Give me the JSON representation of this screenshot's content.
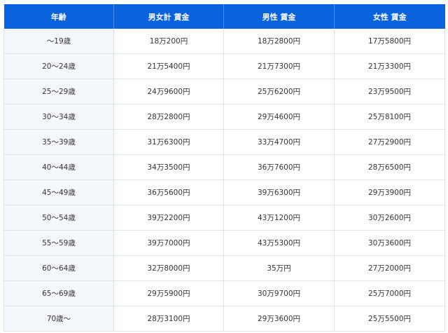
{
  "table": {
    "headers": [
      "年齢",
      "男女計 賃金",
      "男性 賃金",
      "女性 賃金"
    ],
    "rows": [
      {
        "age": "〜19歳",
        "total": "18万200円",
        "male": "18万2800円",
        "female": "17万5800円"
      },
      {
        "age": "20〜24歳",
        "total": "21万5400円",
        "male": "21万7300円",
        "female": "21万3300円"
      },
      {
        "age": "25〜29歳",
        "total": "24万9600円",
        "male": "25万6200円",
        "female": "23万9500円"
      },
      {
        "age": "30〜34歳",
        "total": "28万2800円",
        "male": "29万4600円",
        "female": "25万8100円"
      },
      {
        "age": "35〜39歳",
        "total": "31万6300円",
        "male": "33万4700円",
        "female": "27万2900円"
      },
      {
        "age": "40〜44歳",
        "total": "34万3500円",
        "male": "36万7600円",
        "female": "28万6500円"
      },
      {
        "age": "45〜49歳",
        "total": "36万5600円",
        "male": "39万6300円",
        "female": "29万3900円"
      },
      {
        "age": "50〜54歳",
        "total": "39万2200円",
        "male": "43万1200円",
        "female": "30万2600円"
      },
      {
        "age": "55〜59歳",
        "total": "39万7000円",
        "male": "43万5300円",
        "female": "30万3600円"
      },
      {
        "age": "60〜64歳",
        "total": "32万8000円",
        "male": "35万円",
        "female": "27万2000円"
      },
      {
        "age": "65〜69歳",
        "total": "29万5900円",
        "male": "30万9700円",
        "female": "25万7000円"
      },
      {
        "age": "70歳〜",
        "total": "28万3100円",
        "male": "29万3600円",
        "female": "25万5500円"
      }
    ]
  },
  "colors": {
    "header_bg": "#0a63dd",
    "header_text": "#ffffff",
    "age_cell_bg": "#f4f7fb",
    "border": "#dfe3e8",
    "cell_text": "#333333"
  }
}
